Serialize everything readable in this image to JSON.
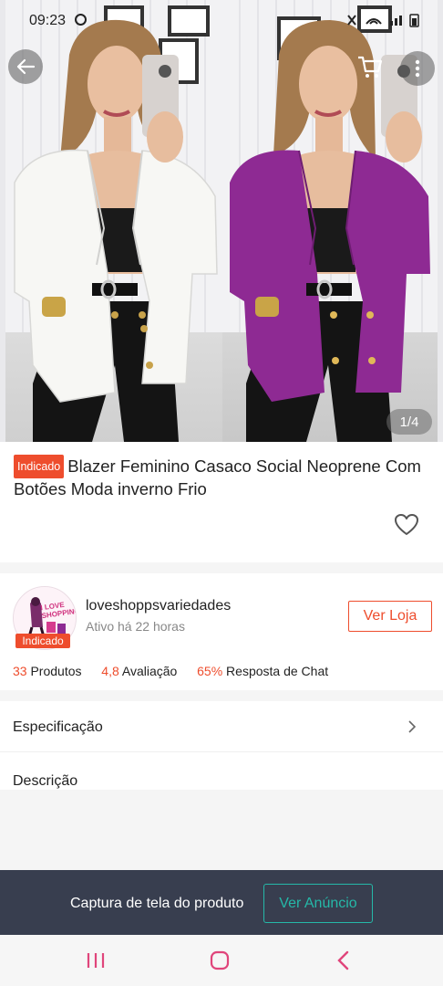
{
  "status_bar": {
    "time": "09:23"
  },
  "hero": {
    "image_counter": "1/4"
  },
  "product": {
    "badge": "Indicado",
    "title": "Blazer Feminino Casaco Social Neoprene Com Botões Moda inverno Frio"
  },
  "seller": {
    "avatar_text": "I LOVE SHOPPING",
    "badge": "Indicado",
    "name": "loveshoppsvariedades",
    "status": "Ativo há 22 horas",
    "visit_button": "Ver Loja",
    "stats": {
      "products_value": "33",
      "products_label": "Produtos",
      "rating_value": "4,8",
      "rating_label": "Avaliação",
      "chat_value": "65%",
      "chat_label": "Resposta de Chat"
    }
  },
  "sections": {
    "specification": "Especificação",
    "description": "Descrição"
  },
  "banner": {
    "text": "Captura de tela do produto",
    "button": "Ver Anúncio"
  },
  "colors": {
    "accent": "#ee4d2d",
    "banner_bg": "#383e4f",
    "banner_button": "#25b8a8",
    "nav_icon": "#e0457b",
    "blazer_white": "#f7f7f4",
    "blazer_purple": "#8e2a93"
  }
}
